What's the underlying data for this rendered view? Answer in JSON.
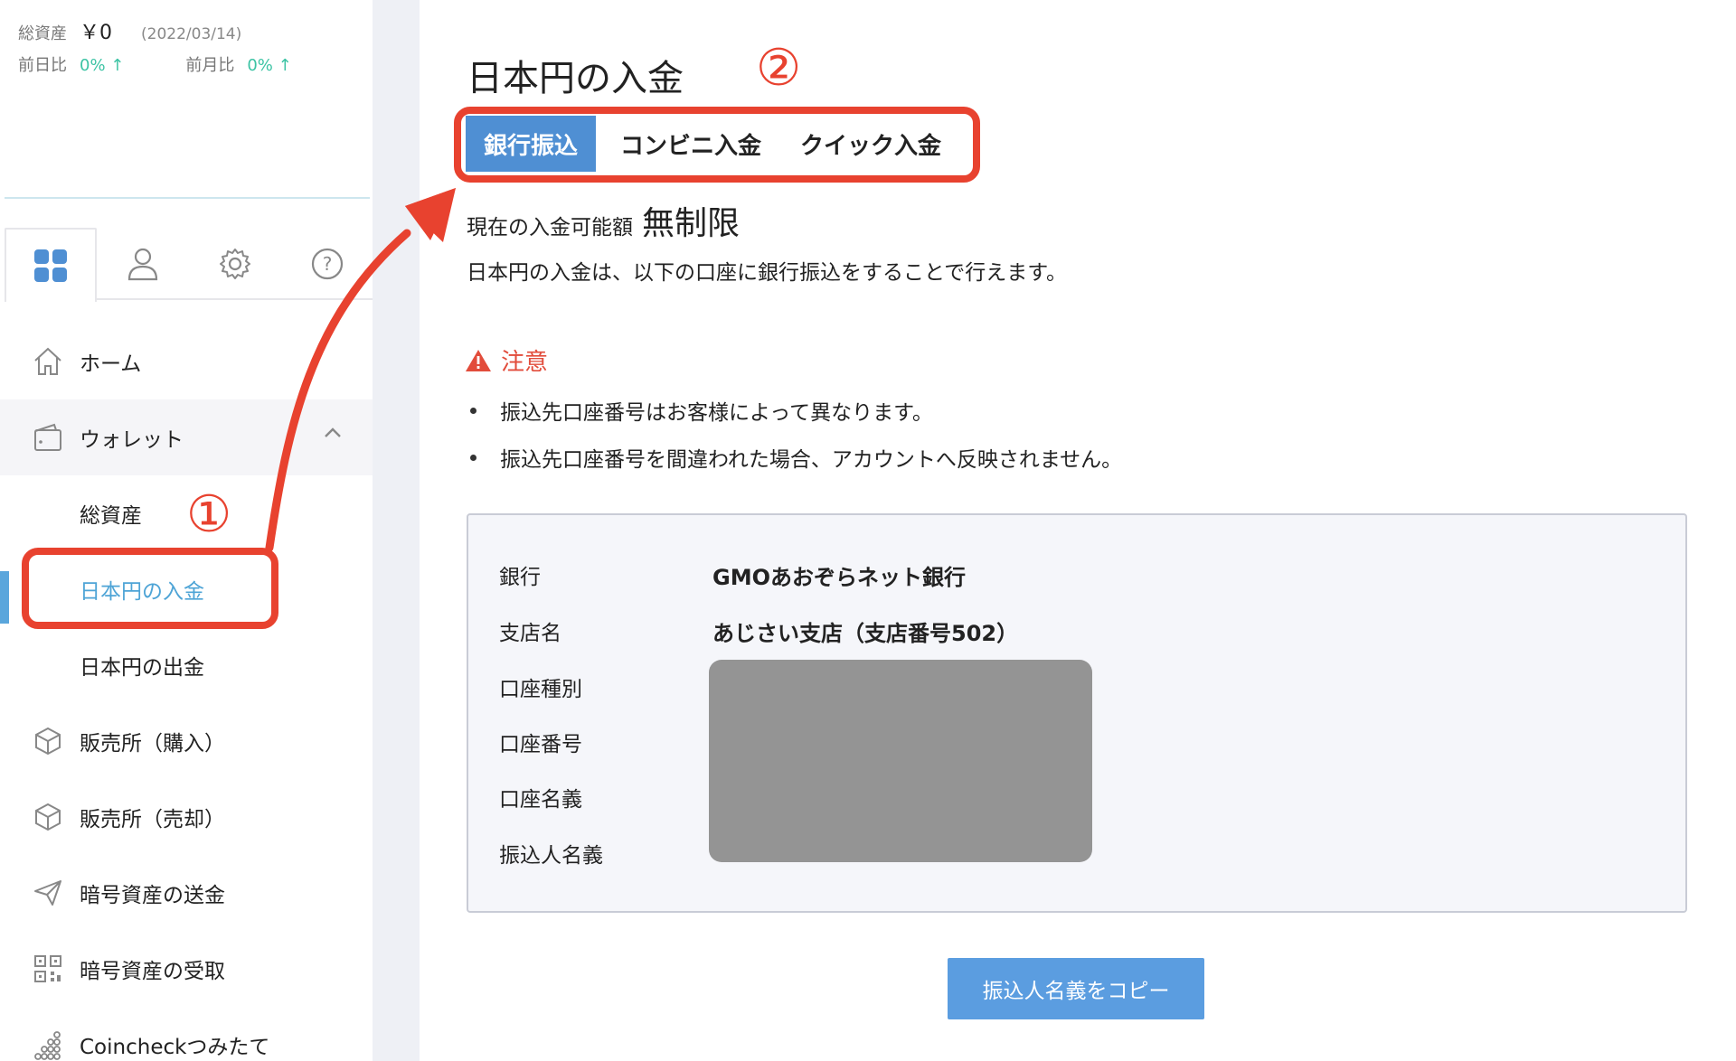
{
  "summary": {
    "total_label": "総資産",
    "total_value": "￥0",
    "date": "(2022/03/14)",
    "day_label": "前日比",
    "day_pct": "0% ↑",
    "month_label": "前月比",
    "month_pct": "0% ↑"
  },
  "sidebar_tabs": [
    {
      "icon": "dashboard-grid-icon",
      "active": true
    },
    {
      "icon": "user-icon",
      "active": false
    },
    {
      "icon": "gear-icon",
      "active": false
    },
    {
      "icon": "help-circle-icon",
      "active": false
    }
  ],
  "nav": {
    "home": "ホーム",
    "wallet": "ウォレット",
    "wallet_sub": {
      "total_assets": "総資産",
      "jpy_deposit": "日本円の入金",
      "jpy_withdraw": "日本円の出金"
    },
    "buy": "販売所（購入）",
    "sell": "販売所（売却）",
    "send": "暗号資産の送金",
    "receive": "暗号資産の受取",
    "tsumitate": "Coincheckつみたて"
  },
  "main": {
    "title": "日本円の入金",
    "tabs": [
      "銀行振込",
      "コンビニ入金",
      "クイック入金"
    ],
    "active_tab": "銀行振込",
    "limit_label": "現在の入金可能額",
    "limit_value": "無制限",
    "intro": "日本円の入金は、以下の口座に銀行振込をすることで行えます。",
    "caution_title": "注意",
    "notes": [
      "振込先口座番号はお客様によって異なります。",
      "振込先口座番号を間違われた場合、アカウントへ反映されません。"
    ],
    "bank": {
      "bank_label": "銀行",
      "bank_value": "GMOあおぞらネット銀行",
      "branch_label": "支店名",
      "branch_value": "あじさい支店（支店番号502）",
      "type_label": "口座種別",
      "number_label": "口座番号",
      "holder_label": "口座名義",
      "sender_label": "振込人名義"
    },
    "copy_button": "振込人名義をコピー"
  },
  "annotations": {
    "step1": "①",
    "step2": "②"
  },
  "colors": {
    "accent_blue": "#4f8fd3",
    "active_link": "#4ea4d6",
    "annotation_red": "#e8422f",
    "positive_green": "#3cc3a4"
  }
}
